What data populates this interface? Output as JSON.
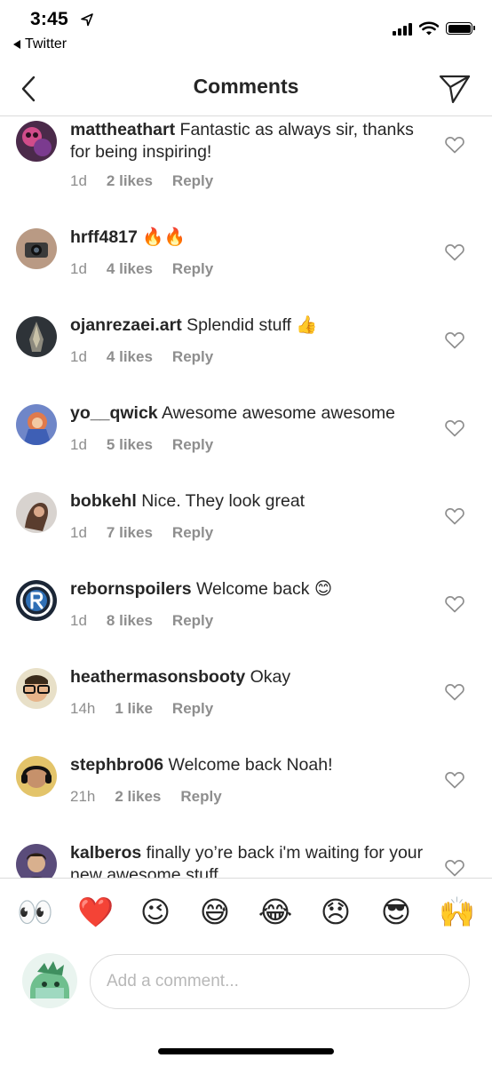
{
  "status_bar": {
    "time": "3:45",
    "back_app": "Twitter"
  },
  "header": {
    "title": "Comments"
  },
  "comments": [
    {
      "user": "mattheathart",
      "text": "Fantastic as always sir, thanks for being inspiring!",
      "age": "1d",
      "likes": "2 likes",
      "reply": "Reply"
    },
    {
      "user": "hrff4817",
      "text": "🔥🔥",
      "age": "1d",
      "likes": "4 likes",
      "reply": "Reply"
    },
    {
      "user": "ojanrezaei.art",
      "text": "Splendid stuff 👍",
      "age": "1d",
      "likes": "4 likes",
      "reply": "Reply"
    },
    {
      "user": "yo__qwick",
      "text": "Awesome awesome awesome",
      "age": "1d",
      "likes": "5 likes",
      "reply": "Reply"
    },
    {
      "user": "bobkehl",
      "text": "Nice. They look great",
      "age": "1d",
      "likes": "7 likes",
      "reply": "Reply"
    },
    {
      "user": "rebornspoilers",
      "text": "Welcome back 😊",
      "age": "1d",
      "likes": "8 likes",
      "reply": "Reply"
    },
    {
      "user": "heathermasonsbooty",
      "text": "Okay",
      "age": "14h",
      "likes": "1 like",
      "reply": "Reply"
    },
    {
      "user": "stephbro06",
      "text": "Welcome back Noah!",
      "age": "21h",
      "likes": "2 likes",
      "reply": "Reply"
    },
    {
      "user": "kalberos",
      "text": "finally yo’re back i'm waiting for your new awesome stuff",
      "age": "",
      "likes": "",
      "reply": ""
    }
  ],
  "emoji_bar": [
    "👀",
    "❤️",
    "😉",
    "😅",
    "😂",
    "😞",
    "😎",
    "🙌"
  ],
  "composer": {
    "placeholder": "Add a comment..."
  }
}
